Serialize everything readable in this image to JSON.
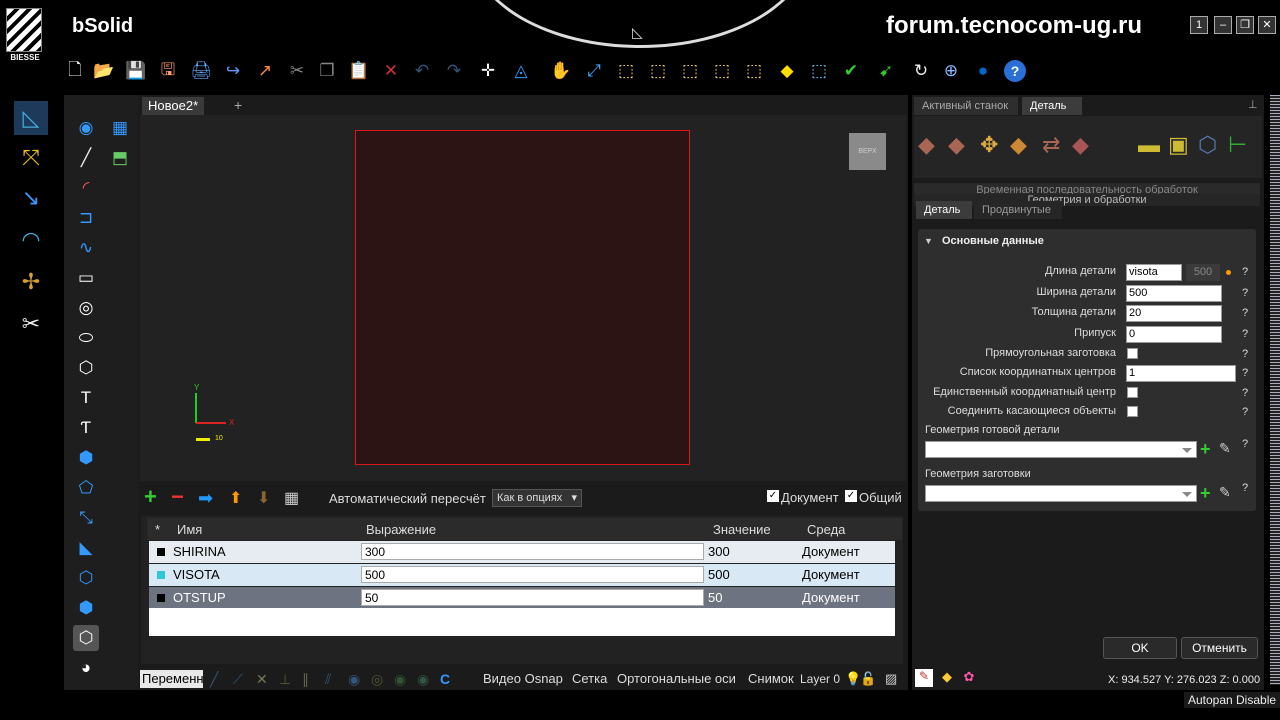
{
  "app": {
    "name": "bSolid",
    "logo_text": "BIESSE",
    "watermark": "forum.tecnocom-ug.ru"
  },
  "window_buttons": [
    "1",
    "–",
    "❐",
    "✕"
  ],
  "toolbar": {
    "icons": [
      "new-icon",
      "open-icon",
      "save-icon",
      "save-as-icon",
      "print-icon",
      "import-icon",
      "export-icon",
      "cut-icon",
      "copy-icon",
      "paste-icon",
      "delete-icon",
      "undo-icon",
      "redo-icon",
      "move-icon",
      "snap-icon",
      "pan-icon",
      "zoom-icon",
      "view-iso-icon",
      "view-front-icon",
      "view-top-icon",
      "view-right-icon",
      "view-back-icon",
      "view-solid-icon",
      "view-wire-icon",
      "render-icon",
      "connect-icon",
      "refresh-icon",
      "globe-icon",
      "sphere-icon",
      "help-icon"
    ]
  },
  "document": {
    "tab": "Новое2*",
    "plus": "+",
    "view_cube": "ВЕРХ",
    "axis_y": "Y",
    "axis_x": "X",
    "axis_scale": "10"
  },
  "bottom_bar": {
    "auto_recalc_label": "Автоматический пересчёт",
    "mode_select": "Как в опциях",
    "document_check": "Документ",
    "common_check": "Общий"
  },
  "variables": {
    "headers": {
      "star": "*",
      "name": "Имя",
      "expression": "Выражение",
      "value": "Значение",
      "scope": "Среда"
    },
    "rows": [
      {
        "name": "SHIRINA",
        "expression": "300",
        "value": "300",
        "scope": "Документ",
        "color": "#000000"
      },
      {
        "name": "VISOTA",
        "expression": "500",
        "value": "500",
        "scope": "Документ",
        "color": "#2ec7d6"
      },
      {
        "name": "OTSTUP",
        "expression": "50",
        "value": "50",
        "scope": "Документ",
        "color": "#000000"
      }
    ]
  },
  "status_bar": {
    "variables_tab": "Переменн",
    "video_osnap": "Видео Osnap",
    "grid": "Сетка",
    "ortho": "Ортогональные оси",
    "snapshot": "Снимок",
    "layer": "Layer 0"
  },
  "right_panel": {
    "tabs": [
      "Активный станок",
      "Деталь"
    ],
    "sequence_label": "Временная последовательность обработок",
    "geometry_label": "Геометрия и обработки",
    "subtabs": [
      "Деталь",
      "Продвинутые"
    ],
    "section_title": "Основные данные",
    "fields": [
      {
        "label": "Длина детали",
        "value": "visota",
        "extra": "500"
      },
      {
        "label": "Ширина детали",
        "value": "500"
      },
      {
        "label": "Толщина детали",
        "value": "20"
      },
      {
        "label": "Припуск",
        "value": "0"
      },
      {
        "label": "Прямоугольная заготовка"
      },
      {
        "label": "Список координатных центров",
        "value": "1"
      },
      {
        "label": "Единственный координатный центр"
      },
      {
        "label": "Соединить касающиеся объекты"
      }
    ],
    "finished_geometry_label": "Геометрия готовой детали",
    "blank_geometry_label": "Геометрия заготовки",
    "question_mark": "?",
    "ok_button": "OK",
    "cancel_button": "Отменить"
  },
  "coords": "X: 934.527  Y: 276.023  Z: 0.000",
  "autopan": "Autopan Disable"
}
